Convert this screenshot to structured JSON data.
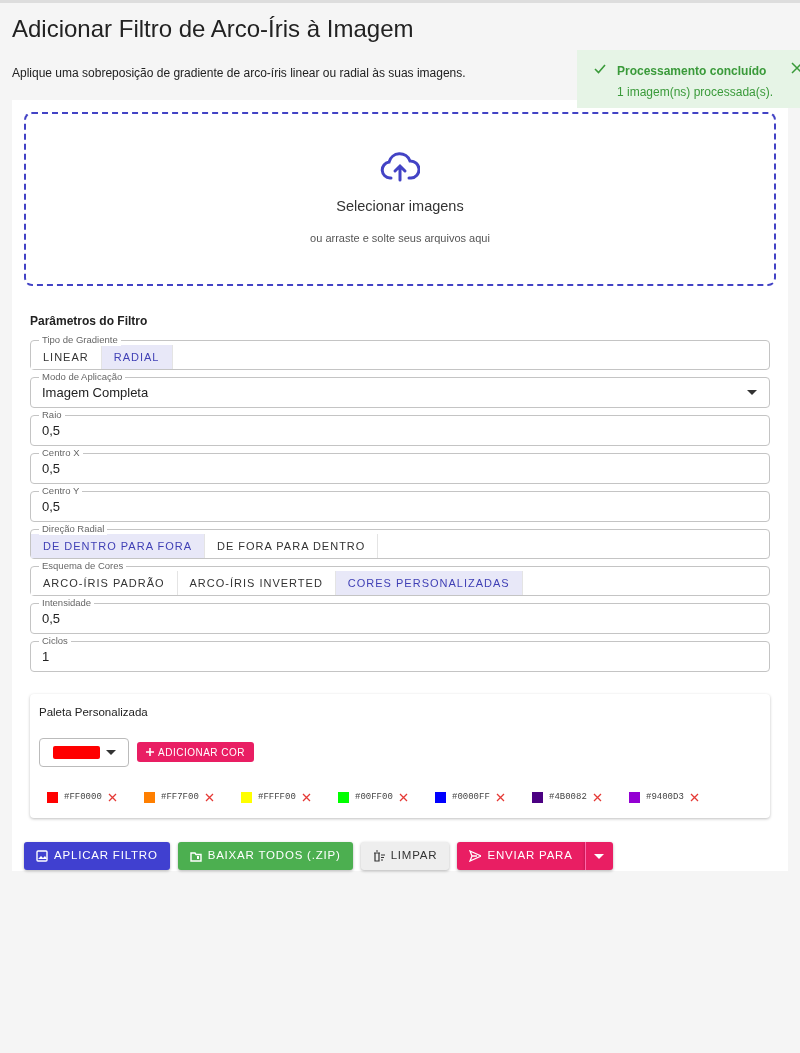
{
  "title": "Adicionar Filtro de Arco-Íris à Imagem",
  "description": "Aplique uma sobreposição de gradiente de arco-íris linear ou radial às suas imagens.",
  "toast": {
    "title": "Processamento concluído",
    "message": "1 imagem(ns) processada(s)."
  },
  "dropzone": {
    "title": "Selecionar imagens",
    "hint": "ou arraste e solte seus arquivos aqui"
  },
  "parameters": {
    "heading": "Parâmetros do Filtro",
    "fields": [
      {
        "kind": "toggle",
        "label": "Tipo de Gradiente",
        "options": [
          {
            "label": "LINEAR",
            "selected": false
          },
          {
            "label": "RADIAL",
            "selected": true
          }
        ]
      },
      {
        "kind": "select",
        "label": "Modo de Aplicação",
        "value": "Imagem Completa"
      },
      {
        "kind": "text",
        "label": "Raio",
        "value": "0,5"
      },
      {
        "kind": "text",
        "label": "Centro X",
        "value": "0,5"
      },
      {
        "kind": "text",
        "label": "Centro Y",
        "value": "0,5"
      },
      {
        "kind": "toggle",
        "label": "Direção Radial",
        "options": [
          {
            "label": "DE DENTRO PARA FORA",
            "selected": true
          },
          {
            "label": "DE FORA PARA DENTRO",
            "selected": false
          }
        ]
      },
      {
        "kind": "toggle",
        "label": "Esquema de Cores",
        "options": [
          {
            "label": "ARCO-ÍRIS PADRÃO",
            "selected": false
          },
          {
            "label": "ARCO-ÍRIS INVERTED",
            "selected": false
          },
          {
            "label": "CORES PERSONALIZADAS",
            "selected": true
          }
        ]
      },
      {
        "kind": "text",
        "label": "Intensidade",
        "value": "0,5"
      },
      {
        "kind": "text",
        "label": "Ciclos",
        "value": "1"
      }
    ]
  },
  "palette": {
    "heading": "Paleta Personalizada",
    "picker": {
      "color": "#ff0000"
    },
    "add_label": "ADICIONAR COR",
    "colors": [
      {
        "label": "#FF0000",
        "color": "#ff0000"
      },
      {
        "label": "#FF7F00",
        "color": "#ff7f00"
      },
      {
        "label": "#FFFF00",
        "color": "#ffff00"
      },
      {
        "label": "#00FF00",
        "color": "#00ff00"
      },
      {
        "label": "#0000FF",
        "color": "#0000ff"
      },
      {
        "label": "#4B0082",
        "color": "#4b0082"
      },
      {
        "label": "#9400D3",
        "color": "#9400d3"
      }
    ]
  },
  "actions": [
    {
      "kind": "apply",
      "label": "APLICAR FILTRO"
    },
    {
      "kind": "download",
      "label": "BAIXAR TODOS (.ZIP)"
    },
    {
      "kind": "clear",
      "label": "LIMPAR"
    },
    {
      "kind": "send",
      "label": "ENVIAR PARA"
    }
  ]
}
